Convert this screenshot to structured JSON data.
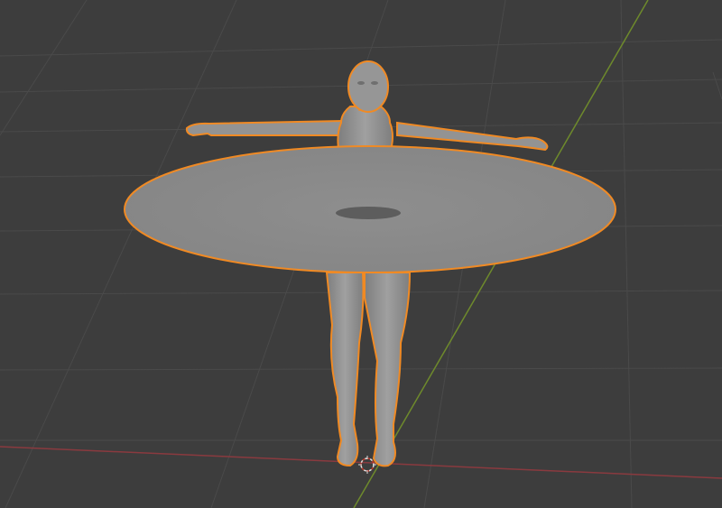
{
  "viewport": {
    "background_color": "#3d3d3d",
    "grid_color": "#4a4a4a",
    "x_axis_color": "#8a3a3f",
    "y_axis_color": "#6e8a2c",
    "selection_outline_color": "#f08a24",
    "mesh_fill_color": "#8c8c8c",
    "mesh_shade_color": "#7a7a7a",
    "mesh_highlight_color": "#a2a2a2",
    "selected_objects": [
      "humanoid-mesh",
      "disc-mesh"
    ],
    "cursor_icon": "3d-cursor-icon"
  }
}
